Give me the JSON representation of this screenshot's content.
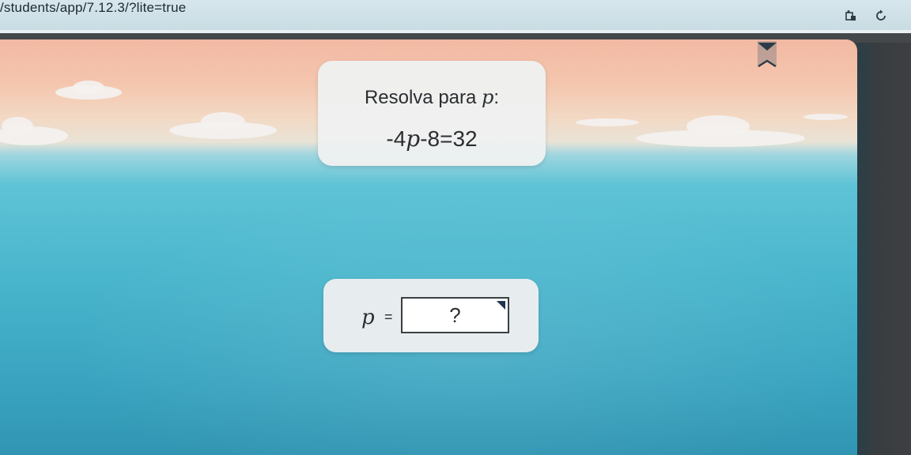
{
  "browser": {
    "url": "/students/app/7.12.3/?lite=true",
    "icons": [
      "extension-icon",
      "refresh-icon"
    ]
  },
  "question": {
    "prompt_text": "Resolva para ",
    "prompt_var": "p",
    "prompt_colon": ":",
    "equation_coef": "-4",
    "equation_var": "p",
    "equation_rest": "-8=32"
  },
  "answer": {
    "var": "p",
    "equals": "=",
    "input_value": "?"
  },
  "colors": {
    "input_corner": "#1f3350",
    "card_bg": "#eef0f0"
  }
}
